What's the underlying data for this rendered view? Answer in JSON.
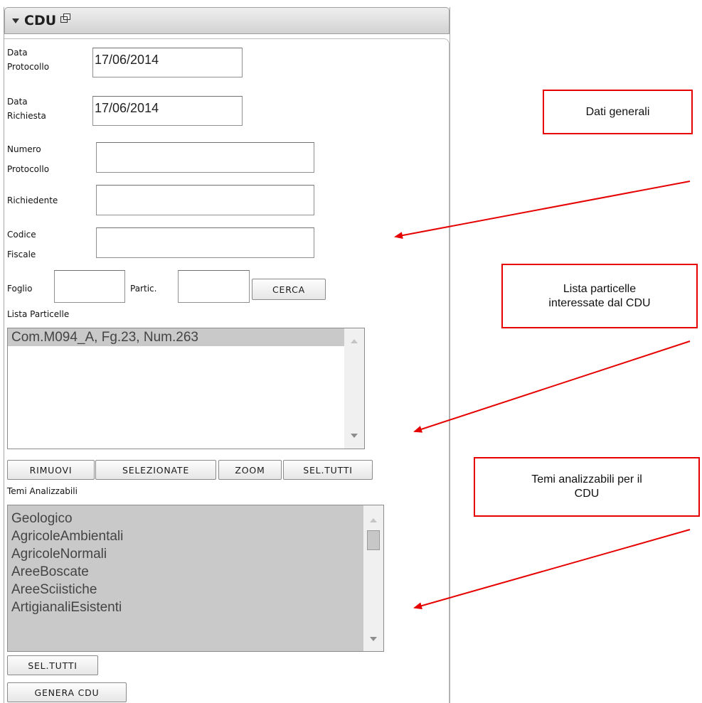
{
  "panel": {
    "title": "CDU"
  },
  "form": {
    "data_protocollo": {
      "label_line1": "Data",
      "label_line2": "Protocollo",
      "value": "17/06/2014"
    },
    "data_richiesta": {
      "label_line1": "Data",
      "label_line2": "Richiesta",
      "value": "17/06/2014"
    },
    "numero_protocollo": {
      "label_line1": "Numero",
      "label_line2": "Protocollo",
      "value": ""
    },
    "richiedente": {
      "label": "Richiedente",
      "value": ""
    },
    "codice_fiscale": {
      "label_line1": "Codice",
      "label_line2": "Fiscale",
      "value": ""
    },
    "foglio": {
      "label": "Foglio",
      "value": ""
    },
    "partic": {
      "label": "Partic.",
      "value": ""
    },
    "cerca_label": "CERCA"
  },
  "lista_particelle": {
    "label": "Lista Particelle",
    "items": [
      "Com.M094_A, Fg.23, Num.263"
    ]
  },
  "particelle_buttons": {
    "rimuovi": "RIMUOVI",
    "selezionate": "SELEZIONATE",
    "zoom": "ZOOM",
    "sel_tutti": "SEL.TUTTI"
  },
  "temi": {
    "label": "Temi Analizzabili",
    "items": [
      "Geologico",
      "AgricoleAmbientali",
      "AgricoleNormali",
      "AreeBoscate",
      "AreeSciistiche",
      "ArtigianaliEsistenti"
    ],
    "sel_tutti_label": "SEL.TUTTI",
    "genera_label": "GENERA CDU"
  },
  "annotations": {
    "dati_generali": "Dati generali",
    "lista_particelle_line1": "Lista particelle",
    "lista_particelle_line2": "interessate dal CDU",
    "temi_line1": "Temi analizzabili per il",
    "temi_line2": "CDU"
  },
  "colors": {
    "annotation": "#e60000",
    "selection": "#c9c9c9"
  }
}
